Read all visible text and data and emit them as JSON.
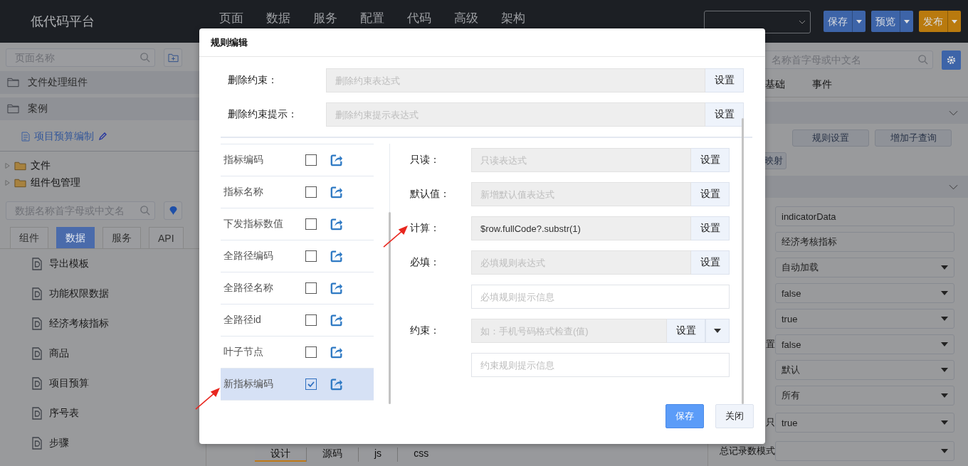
{
  "header": {
    "logo": "低代码平台",
    "nav": [
      "页面",
      "数据",
      "服务",
      "配置",
      "代码",
      "高级",
      "架构"
    ],
    "buttons": [
      {
        "label": "保存",
        "kind": "primary"
      },
      {
        "label": "预览",
        "kind": "primary"
      },
      {
        "label": "发布",
        "kind": "warning"
      }
    ]
  },
  "left": {
    "search": {
      "placeholder": "页面名称"
    },
    "folders": [
      {
        "label": "文件处理组件"
      },
      {
        "label": "案例",
        "children": [
          {
            "label": "项目预算编制"
          }
        ]
      }
    ],
    "tree": [
      {
        "label": "文件",
        "expanded": false
      },
      {
        "label": "组件包管理",
        "expanded": false
      }
    ],
    "data_search": {
      "placeholder": "数据名称首字母或中文名"
    },
    "tabs": [
      {
        "label": "组件",
        "selected": false
      },
      {
        "label": "数据",
        "selected": true
      },
      {
        "label": "服务",
        "selected": false
      },
      {
        "label": "API",
        "selected": false
      }
    ],
    "items": [
      "导出模板",
      "功能权限数据",
      "经济考核指标",
      "商品",
      "项目预算",
      "序号表",
      "步骤"
    ]
  },
  "bottom_tabs": [
    {
      "label": "设计",
      "selected": true
    },
    {
      "label": "源码",
      "selected": false
    },
    {
      "label": "js",
      "selected": false
    },
    {
      "label": "css",
      "selected": false
    }
  ],
  "right": {
    "search": {
      "placeholder": "名称首字母或中文名"
    },
    "tabs": [
      "基础",
      "事件"
    ],
    "buttons": [
      "规则设置",
      "增加子查询",
      "映射"
    ],
    "props": [
      {
        "value": "indicatorData",
        "kind": "text"
      },
      {
        "value": "经济考核指标",
        "kind": "text"
      },
      {
        "value": "自动加载",
        "kind": "select"
      },
      {
        "value": "false",
        "kind": "select"
      },
      {
        "value": "true",
        "kind": "select"
      },
      {
        "label": "置",
        "value": "false",
        "kind": "select"
      },
      {
        "value": "默认",
        "kind": "select"
      },
      {
        "value": "所有",
        "kind": "select"
      },
      {
        "label": "只",
        "value": "true",
        "kind": "select"
      },
      {
        "label": "总记录数模式",
        "kind": "select"
      }
    ]
  },
  "modal": {
    "title": "规则编辑",
    "top_rows": [
      {
        "label": "删除约束：",
        "placeholder": "删除约束表达式",
        "button": "设置"
      },
      {
        "label": "删除约束提示：",
        "placeholder": "删除约束提示表达式",
        "button": "设置"
      }
    ],
    "fields": [
      {
        "label": "指标编码",
        "checked": false,
        "selected": false
      },
      {
        "label": "指标名称",
        "checked": false,
        "selected": false
      },
      {
        "label": "下发指标数值",
        "checked": false,
        "selected": false
      },
      {
        "label": "全路径编码",
        "checked": false,
        "selected": false
      },
      {
        "label": "全路径名称",
        "checked": false,
        "selected": false
      },
      {
        "label": "全路径id",
        "checked": false,
        "selected": false
      },
      {
        "label": "叶子节点",
        "checked": false,
        "selected": false
      },
      {
        "label": "新指标编码",
        "checked": true,
        "selected": true
      }
    ],
    "rules": [
      {
        "kind": "expression",
        "label": "只读：",
        "placeholder": "只读表达式",
        "button": "设置"
      },
      {
        "kind": "expression",
        "label": "默认值：",
        "placeholder": "新增默认值表达式",
        "button": "设置"
      },
      {
        "kind": "expression",
        "label": "计算：",
        "value": "$row.fullCode?.substr(1)",
        "button": "设置"
      },
      {
        "kind": "expression",
        "label": "必填：",
        "placeholder": "必填规则表达式",
        "button": "设置"
      },
      {
        "kind": "message",
        "placeholder": "必填规则提示信息"
      },
      {
        "kind": "dropdown",
        "label": "约束：",
        "placeholder": "如：手机号码格式检查(值)",
        "button": "设置"
      },
      {
        "kind": "message",
        "placeholder": "约束规则提示信息"
      }
    ],
    "buttons": [
      {
        "label": "保存",
        "kind": "primary"
      },
      {
        "label": "关闭",
        "kind": "default"
      }
    ]
  }
}
